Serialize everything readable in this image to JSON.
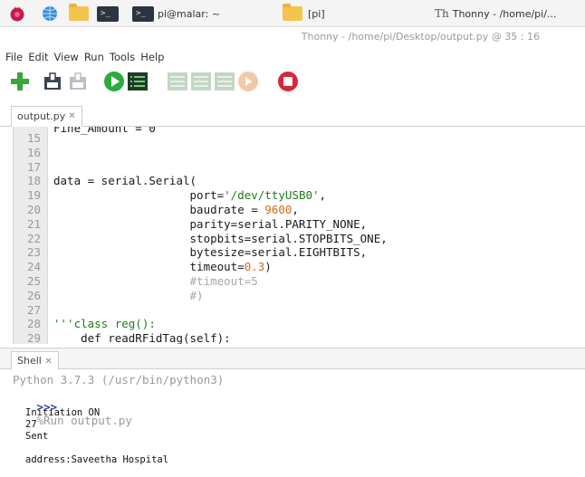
{
  "taskbar": {
    "terminal_task": "pi@malar: ~",
    "folder_task": "[pi]",
    "thonny_task": "Thonny  -  /home/pi/..."
  },
  "window": {
    "title": "Thonny  -  /home/pi/Desktop/output.py  @  35 : 16"
  },
  "menu": [
    "File",
    "Edit",
    "View",
    "Run",
    "Tools",
    "Help"
  ],
  "toolbar": {
    "icons": [
      "new-file-icon",
      "open-file-icon",
      "save-file-icon",
      "run-icon",
      "debug-icon",
      "step-over-icon",
      "step-into-icon",
      "step-out-icon",
      "resume-icon",
      "stop-icon"
    ]
  },
  "editor": {
    "tab_label": "output.py",
    "tab_close": "✕",
    "partial_line": "Fine_Amount = 0",
    "lines": [
      {
        "n": "15"
      },
      {
        "n": "16"
      },
      {
        "n": "17"
      },
      {
        "n": "18",
        "code": "data = serial.Serial("
      },
      {
        "n": "19",
        "pre": "                    port=",
        "str": "'/dev/ttyUSB0'",
        "post": ","
      },
      {
        "n": "20",
        "pre": "                    baudrate = ",
        "num": "9600",
        "post": ","
      },
      {
        "n": "21",
        "code": "                    parity=serial.PARITY_NONE,"
      },
      {
        "n": "22",
        "code": "                    stopbits=serial.STOPBITS_ONE,"
      },
      {
        "n": "23",
        "code": "                    bytesize=serial.EIGHTBITS,"
      },
      {
        "n": "24",
        "pre": "                    timeout=",
        "num": "0.3",
        "post": ")"
      },
      {
        "n": "25",
        "pre": "                    ",
        "comment": "#timeout=5"
      },
      {
        "n": "26",
        "pre": "                    ",
        "comment": "#)"
      },
      {
        "n": "27"
      },
      {
        "n": "28",
        "str": "'''class reg():"
      },
      {
        "n": "29",
        "code": "    def readRFidTag(self):"
      }
    ]
  },
  "shell": {
    "tab_label": "Shell",
    "tab_close": "✕",
    "python_version": "Python 3.7.3 (/usr/bin/python3)",
    "prompt": ">>>",
    "command": "%Run output.py",
    "output": [
      "Initiation ON",
      "27",
      "Sent",
      "",
      "address:Saveetha Hospital"
    ]
  },
  "colors": {
    "string": "#1f7a1f",
    "number": "#d46a1a",
    "comment": "#a8a8a8",
    "prompt": "#2e3ea6",
    "run_green": "#2bab3e",
    "stop_red": "#d9253a"
  }
}
